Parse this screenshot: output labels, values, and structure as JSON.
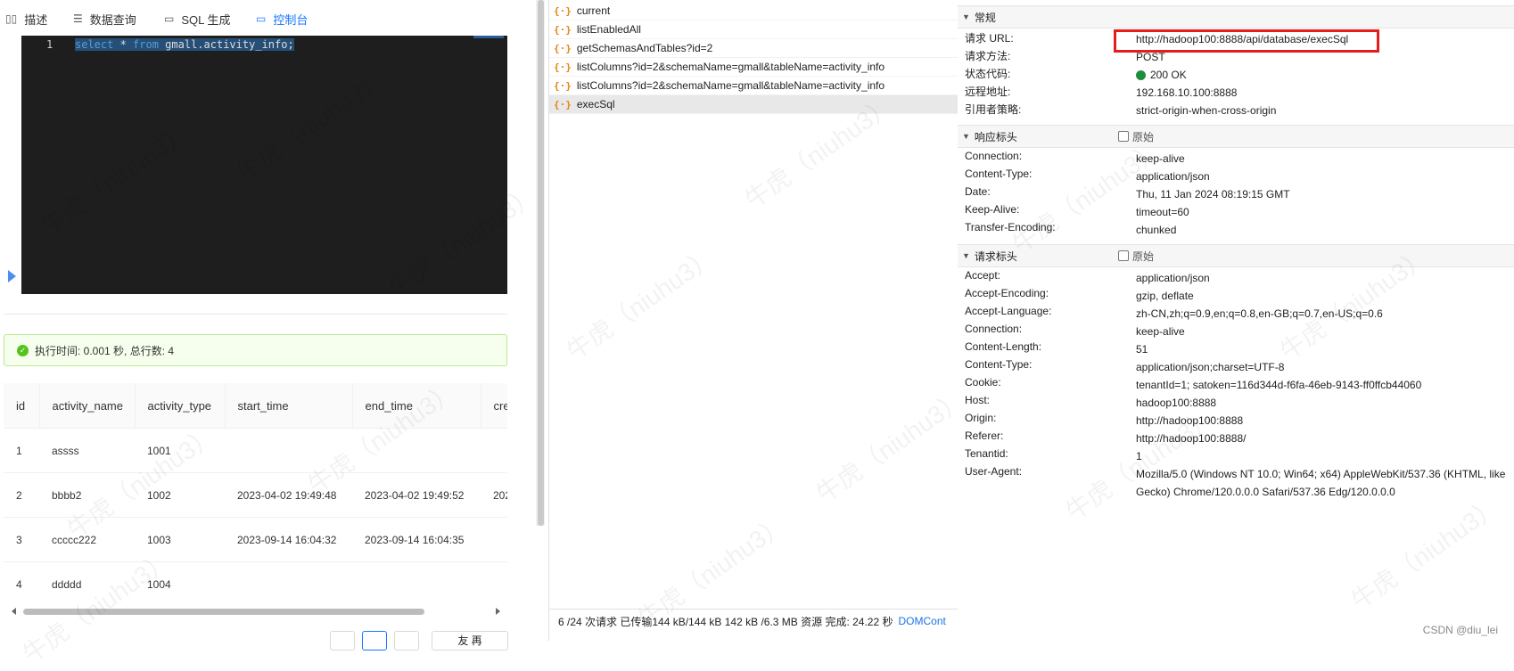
{
  "tabs": [
    {
      "icon": "book-icon",
      "glyph": "▯▯",
      "label": "描述"
    },
    {
      "icon": "list-icon",
      "glyph": "☰",
      "label": "数据查询"
    },
    {
      "icon": "monitor-icon",
      "glyph": "▭",
      "label": "SQL 生成"
    },
    {
      "icon": "console-icon",
      "glyph": "▭",
      "label": "控制台"
    }
  ],
  "editor": {
    "line_number": "1",
    "code": "select * from gmall.activity_info;"
  },
  "result": {
    "status": "执行时间: 0.001 秒, 总行数: 4"
  },
  "table": {
    "columns": [
      "id",
      "activity_name",
      "activity_type",
      "start_time",
      "end_time",
      "crea"
    ],
    "rows": [
      [
        "1",
        "assss",
        "1001",
        "",
        "",
        ""
      ],
      [
        "2",
        "bbbb2",
        "1002",
        "2023-04-02 19:49:48",
        "2023-04-02 19:49:52",
        "202"
      ],
      [
        "3",
        "ccccc222",
        "1003",
        "2023-09-14 16:04:32",
        "2023-09-14 16:04:35",
        ""
      ],
      [
        "4",
        "ddddd",
        "1004",
        "",
        "",
        ""
      ]
    ]
  },
  "pager": {
    "next_label": "友 再"
  },
  "requests": [
    {
      "name": "current",
      "selected": false
    },
    {
      "name": "listEnabledAll",
      "selected": false
    },
    {
      "name": "getSchemasAndTables?id=2",
      "selected": false
    },
    {
      "name": "listColumns?id=2&schemaName=gmall&tableName=activity_info",
      "selected": false
    },
    {
      "name": "listColumns?id=2&schemaName=gmall&tableName=activity_info",
      "selected": false
    },
    {
      "name": "execSql",
      "selected": true
    }
  ],
  "request_icon": "{·}",
  "statusbar": {
    "text": "6 /24 次请求  已传输144 kB/144 kB  142 kB /6.3 MB 资源  完成: 24.22 秒",
    "dom": "DOMCont"
  },
  "general": {
    "title": "常规",
    "rows": [
      {
        "k": "请求 URL:",
        "v": "http://hadoop100:8888/api/database/execSql"
      },
      {
        "k": "请求方法:",
        "v": "POST"
      },
      {
        "k": "状态代码:",
        "v": "200 OK"
      },
      {
        "k": "远程地址:",
        "v": "192.168.10.100:8888"
      },
      {
        "k": "引用者策略:",
        "v": "strict-origin-when-cross-origin"
      }
    ]
  },
  "response_headers": {
    "title": "响应标头",
    "raw_label": "原始",
    "rows": [
      {
        "k": "Connection:",
        "v": "keep-alive"
      },
      {
        "k": "Content-Type:",
        "v": "application/json"
      },
      {
        "k": "Date:",
        "v": "Thu, 11 Jan 2024 08:19:15 GMT"
      },
      {
        "k": "Keep-Alive:",
        "v": "timeout=60"
      },
      {
        "k": "Transfer-Encoding:",
        "v": "chunked"
      }
    ]
  },
  "request_headers": {
    "title": "请求标头",
    "raw_label": "原始",
    "rows": [
      {
        "k": "Accept:",
        "v": "application/json"
      },
      {
        "k": "Accept-Encoding:",
        "v": "gzip, deflate"
      },
      {
        "k": "Accept-Language:",
        "v": "zh-CN,zh;q=0.9,en;q=0.8,en-GB;q=0.7,en-US;q=0.6"
      },
      {
        "k": "Connection:",
        "v": "keep-alive"
      },
      {
        "k": "Content-Length:",
        "v": "51"
      },
      {
        "k": "Content-Type:",
        "v": "application/json;charset=UTF-8"
      },
      {
        "k": "Cookie:",
        "v": "tenantId=1; satoken=116d344d-f6fa-46eb-9143-ff0ffcb44060"
      },
      {
        "k": "Host:",
        "v": "hadoop100:8888"
      },
      {
        "k": "Origin:",
        "v": "http://hadoop100:8888"
      },
      {
        "k": "Referer:",
        "v": "http://hadoop100:8888/"
      },
      {
        "k": "Tenantid:",
        "v": "1"
      },
      {
        "k": "User-Agent:",
        "v": "Mozilla/5.0 (Windows NT 10.0; Win64; x64) AppleWebKit/537.36 (KHTML, like Gecko) Chrome/120.0.0.0 Safari/537.36 Edg/120.0.0.0"
      }
    ]
  },
  "colors": {
    "accent": "#1677ff",
    "success": "#52c41a",
    "highlight_box": "#e41d1d",
    "status_ok": "#1e8e3e"
  },
  "watermark": "牛虎（niuhu3）",
  "credit": "CSDN @diu_lei"
}
